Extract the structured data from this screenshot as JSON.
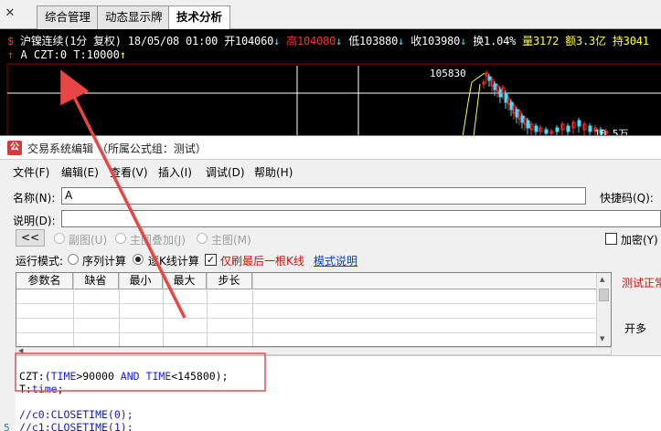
{
  "tabs": [
    {
      "label": "综合管理",
      "active": false
    },
    {
      "label": "动态显示牌",
      "active": false
    },
    {
      "label": "技术分析",
      "active": true
    }
  ],
  "chart": {
    "symbol_icon": "$",
    "instrument": "沪镍连续(1分 复权)",
    "datetime": "18/05/08 01:00",
    "open": "开104060",
    "high": "高104080",
    "low": "低103880",
    "close": "收103980",
    "turnover": "换1.04%",
    "volume": "量3172",
    "amount": "额3.3亿",
    "position": "持3041",
    "indicator_line": "A CZT:0 T:10000",
    "price_label": "105830",
    "price_label2": "10.5万",
    "colors": {
      "up": "#ff3030",
      "down": "#40e0ff",
      "highlight": "#ffff40"
    }
  },
  "dialog": {
    "title": "交易系统编辑 （所属公式组：测试）",
    "menu": [
      "文件(F)",
      "编辑(E)",
      "查看(V)",
      "插入(I)",
      "调试(D)",
      "帮助(H)"
    ],
    "name_label": "名称(N):",
    "name_value": "A",
    "shortcut_label": "快捷码(Q):",
    "desc_label": "说明(D):",
    "desc_value": "",
    "nav_button": "<<",
    "sub_chart": "副图(U)",
    "main_overlay": "主图叠加(J)",
    "main_chart": "主图(M)",
    "encrypt": "加密(Y)",
    "run_mode_label": "运行模式:",
    "mode_sequence": "序列计算",
    "mode_tick": "逐K线计算",
    "refresh_last": "仅刷最后一根K线",
    "mode_help": "模式说明",
    "param_headers": [
      "参数名",
      "缺省",
      "最小",
      "最大",
      "步长"
    ],
    "test_status": "测试正常",
    "open_button": "开多",
    "code_lines": [
      {
        "text_parts": [
          {
            "t": "CZT:(",
            "c": ""
          },
          {
            "t": "TIME",
            "c": "kw"
          },
          {
            "t": ">90000 ",
            "c": ""
          },
          {
            "t": "AND",
            "c": "kw"
          },
          {
            "t": " ",
            "c": ""
          },
          {
            "t": "TIME",
            "c": "kw"
          },
          {
            "t": "<145800);",
            "c": ""
          }
        ]
      },
      {
        "text_parts": [
          {
            "t": "T:",
            "c": ""
          },
          {
            "t": "time",
            "c": "kw"
          },
          {
            "t": ";",
            "c": ""
          }
        ]
      },
      {
        "text_parts": []
      },
      {
        "text_parts": [
          {
            "t": "//c0:CLOSETIME(0);",
            "c": "cm"
          }
        ]
      },
      {
        "text_parts": [
          {
            "t": "//c1:CLOSETIME(1);",
            "c": "cm"
          }
        ]
      }
    ],
    "line_number": "5"
  }
}
